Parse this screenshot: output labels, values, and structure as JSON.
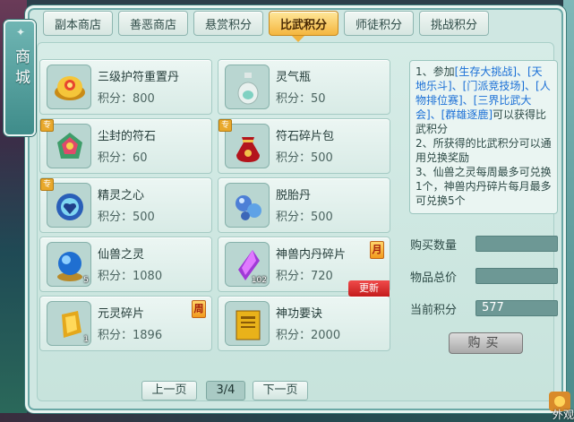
{
  "sidebar": {
    "title": "商城"
  },
  "tabs": [
    {
      "label": "副本商店",
      "active": false
    },
    {
      "label": "善恶商店",
      "active": false
    },
    {
      "label": "悬赏积分",
      "active": false
    },
    {
      "label": "比武积分",
      "active": true
    },
    {
      "label": "师徒积分",
      "active": false
    },
    {
      "label": "挑战积分",
      "active": false
    }
  ],
  "items": [
    {
      "name": "三级护符重置丹",
      "price": "积分：800",
      "icon": "golden-pill-icon"
    },
    {
      "name": "灵气瓶",
      "price": "积分：50",
      "icon": "vase-icon"
    },
    {
      "name": "尘封的符石",
      "price": "积分：60",
      "icon": "rune-stone-icon",
      "tag": "专"
    },
    {
      "name": "符石碎片包",
      "price": "积分：500",
      "icon": "red-bag-icon",
      "tag": "专"
    },
    {
      "name": "精灵之心",
      "price": "积分：500",
      "icon": "spirit-heart-icon",
      "tag": "专"
    },
    {
      "name": "脱胎丹",
      "price": "积分：500",
      "icon": "blue-pill-icon"
    },
    {
      "name": "仙兽之灵",
      "price": "积分：1080",
      "icon": "blue-orb-icon",
      "qty": "5"
    },
    {
      "name": "神兽内丹碎片",
      "price": "积分：720",
      "icon": "purple-crystal-icon",
      "qty": "102",
      "month": "月",
      "new": "更新"
    },
    {
      "name": "元灵碎片",
      "price": "积分：1896",
      "icon": "gold-shard-icon",
      "qty": "1",
      "month": "周"
    },
    {
      "name": "神功要诀",
      "price": "积分：2000",
      "icon": "yellow-book-icon"
    }
  ],
  "pager": {
    "prev": "上一页",
    "page": "3/4",
    "next": "下一页"
  },
  "info": {
    "p1_a": "1、参加",
    "p1_b": "[生存大挑战]、[天地乐斗]、[门派竞技场]、[人物排位赛]、[三界比武大会]、[群雄逐鹿]",
    "p1_c": "可以获得比武积分",
    "p2": "2、所获得的比武积分可以通用兑换奖励",
    "p3": "3、仙兽之灵每周最多可兑换1个，神兽内丹碎片每月最多可兑换5个"
  },
  "fields": {
    "qty_label": "购买数量",
    "qty_value": "",
    "total_label": "物品总价",
    "total_value": "",
    "points_label": "当前积分",
    "points_value": "577"
  },
  "buy": {
    "label": "购买"
  },
  "corner": {
    "label": "外观"
  },
  "colors": {
    "accent": "#f4b63f",
    "frame": "#cfe7e2",
    "new_tag": "#d92a2a",
    "link": "#1a6fd6"
  }
}
